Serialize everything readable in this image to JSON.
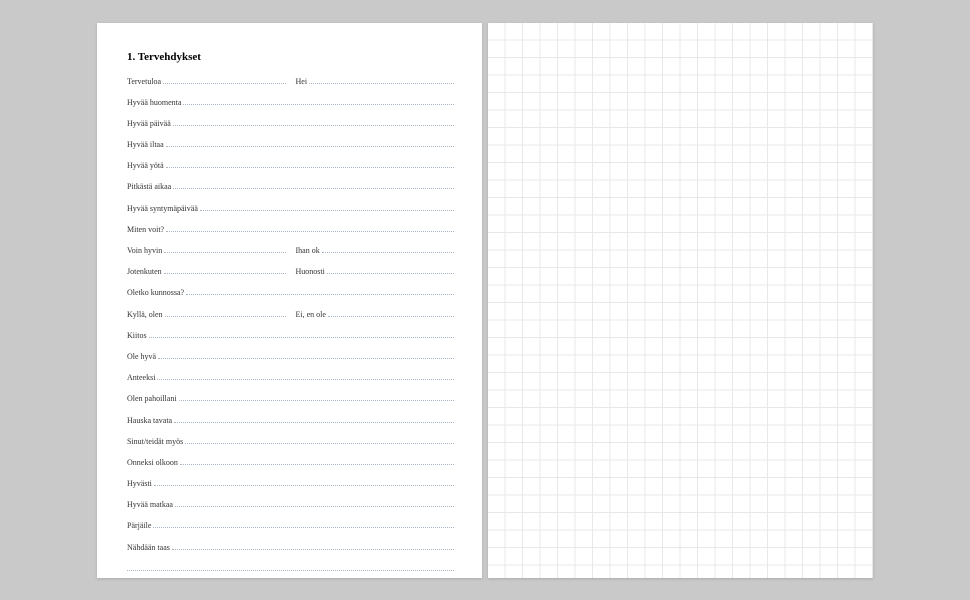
{
  "heading": "1. Tervehdykset",
  "rows": [
    {
      "type": "pair",
      "left": "Tervetuloa",
      "right": "Hei"
    },
    {
      "type": "single",
      "text": "Hyvää huomenta"
    },
    {
      "type": "single",
      "text": "Hyvää päivää"
    },
    {
      "type": "single",
      "text": "Hyvää iltaa"
    },
    {
      "type": "single",
      "text": "Hyvää yötä"
    },
    {
      "type": "single",
      "text": "Pitkästä aikaa"
    },
    {
      "type": "single",
      "text": "Hyvää syntymäpäivää"
    },
    {
      "type": "single",
      "text": "Miten voit?"
    },
    {
      "type": "pair",
      "left": "Voin hyvin",
      "right": "Ihan ok"
    },
    {
      "type": "pair",
      "left": "Jotenkuten",
      "right": "Huonosti"
    },
    {
      "type": "single",
      "text": "Oletko kunnossa?"
    },
    {
      "type": "pair",
      "left": "Kyllä, olen",
      "right": "Ei, en ole"
    },
    {
      "type": "single",
      "text": "Kiitos"
    },
    {
      "type": "single",
      "text": "Ole hyvä"
    },
    {
      "type": "single",
      "text": "Anteeksi"
    },
    {
      "type": "single",
      "text": "Olen pahoillani"
    },
    {
      "type": "single",
      "text": "Hauska tavata"
    },
    {
      "type": "single",
      "text": "Sinut/teidät myös"
    },
    {
      "type": "single",
      "text": "Onneksi olkoon"
    },
    {
      "type": "single",
      "text": "Hyvästi"
    },
    {
      "type": "single",
      "text": "Hyvää matkaa"
    },
    {
      "type": "single",
      "text": "Pärjäile"
    },
    {
      "type": "single",
      "text": "Nähdään taas"
    },
    {
      "type": "blank"
    }
  ]
}
